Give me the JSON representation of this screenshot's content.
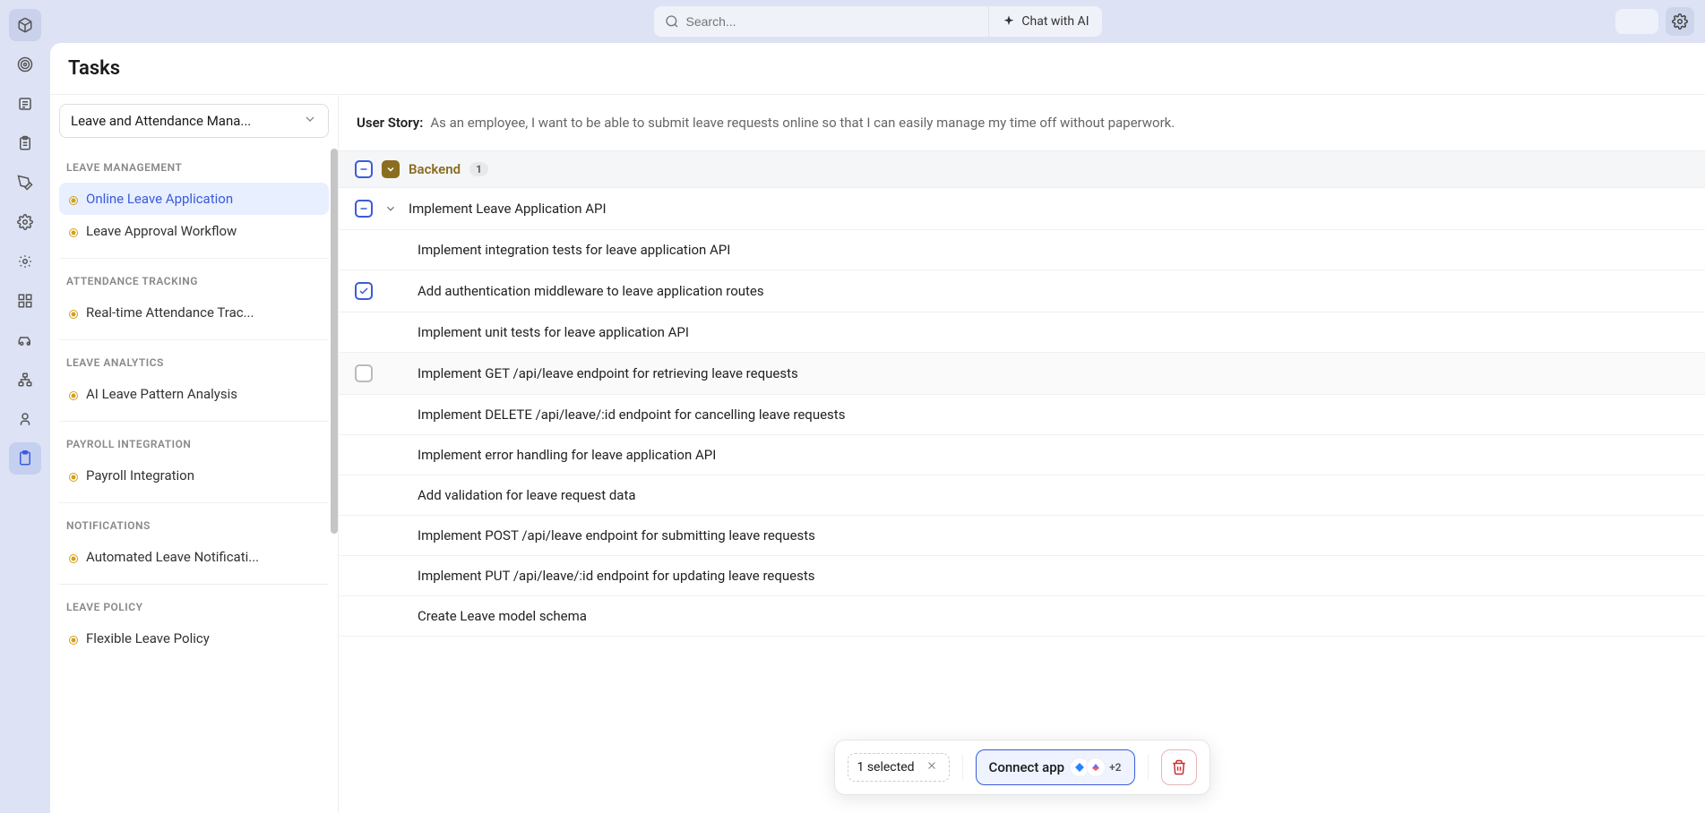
{
  "topbar": {
    "search_placeholder": "Search...",
    "chat_ai_label": "Chat with AI"
  },
  "page": {
    "title": "Tasks"
  },
  "project_selector": {
    "label": "Leave and Attendance Mana..."
  },
  "sidebar_groups": [
    {
      "label": "LEAVE MANAGEMENT",
      "items": [
        {
          "label": "Online Leave Application",
          "active": true
        },
        {
          "label": "Leave Approval Workflow",
          "active": false
        }
      ]
    },
    {
      "label": "ATTENDANCE TRACKING",
      "items": [
        {
          "label": "Real-time Attendance Trac...",
          "active": false
        }
      ]
    },
    {
      "label": "LEAVE ANALYTICS",
      "items": [
        {
          "label": "AI Leave Pattern Analysis",
          "active": false
        }
      ]
    },
    {
      "label": "PAYROLL INTEGRATION",
      "items": [
        {
          "label": "Payroll Integration",
          "active": false
        }
      ]
    },
    {
      "label": "NOTIFICATIONS",
      "items": [
        {
          "label": "Automated Leave Notificati...",
          "active": false
        }
      ]
    },
    {
      "label": "LEAVE POLICY",
      "items": [
        {
          "label": "Flexible Leave Policy",
          "active": false
        }
      ]
    }
  ],
  "user_story": {
    "label": "User Story:",
    "text": "As an employee, I want to be able to submit leave requests online so that I can easily manage my time off without paperwork."
  },
  "section": {
    "title": "Backend",
    "count": "1"
  },
  "tasks": [
    {
      "title": "Implement Leave Application API",
      "level": 1,
      "expandable": true,
      "checkbox": "mixed"
    },
    {
      "title": "Implement integration tests for leave application API",
      "level": 2,
      "checkbox": "none"
    },
    {
      "title": "Add authentication middleware to leave application routes",
      "level": 2,
      "checkbox": "checked"
    },
    {
      "title": "Implement unit tests for leave application API",
      "level": 2,
      "checkbox": "none"
    },
    {
      "title": "Implement GET /api/leave endpoint for retrieving leave requests",
      "level": 2,
      "checkbox": "empty",
      "hover": true
    },
    {
      "title": "Implement DELETE /api/leave/:id endpoint for cancelling leave requests",
      "level": 2,
      "checkbox": "none"
    },
    {
      "title": "Implement error handling for leave application API",
      "level": 2,
      "checkbox": "none"
    },
    {
      "title": "Add validation for leave request data",
      "level": 2,
      "checkbox": "none"
    },
    {
      "title": "Implement POST /api/leave endpoint for submitting leave requests",
      "level": 2,
      "checkbox": "none"
    },
    {
      "title": "Implement PUT /api/leave/:id endpoint for updating leave requests",
      "level": 2,
      "checkbox": "none"
    },
    {
      "title": "Create Leave model schema",
      "level": 2,
      "checkbox": "none"
    }
  ],
  "floating": {
    "selected_label": "1 selected",
    "connect_label": "Connect app",
    "more_count": "+2"
  }
}
